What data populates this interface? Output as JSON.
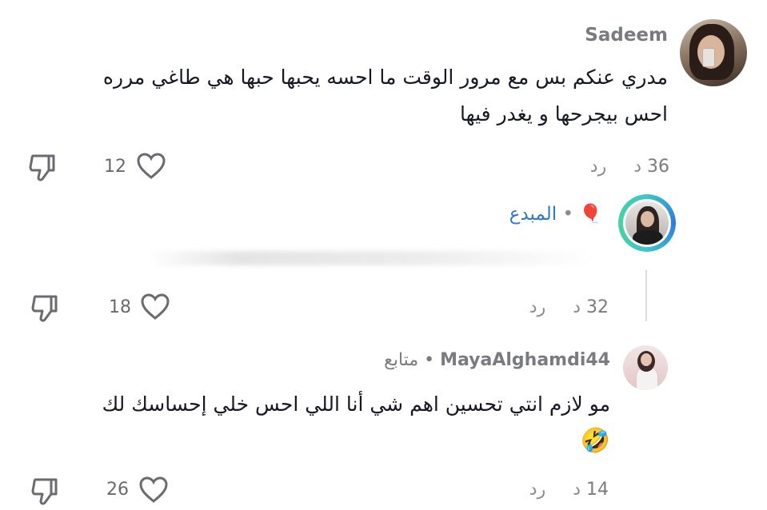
{
  "comments": [
    {
      "username": "Sadeem",
      "text_line1": "مدري عنكم بس مع مرور الوقت ما احسه يحبها حبها هي طاغي مرره",
      "text_line2": "احس بيجرحها و يغدر فيها",
      "time": "36",
      "time_unit": "د",
      "reply_label": "رد",
      "likes": "12"
    },
    {
      "username": "المبدع",
      "username_emoji": "🎈",
      "separator": "•",
      "time": "32",
      "time_unit": "د",
      "reply_label": "رد",
      "likes": "18"
    },
    {
      "username": "MayaAlghamdi44",
      "separator": "•",
      "badge": "متابع",
      "text": "مو لازم انتي تحسين اهم شي أنا اللي احس خلي إحساسك لك",
      "emoji": "🤣",
      "time": "14",
      "time_unit": "د",
      "reply_label": "رد",
      "likes": "26"
    }
  ],
  "icons": {
    "like": "heart-outline-icon",
    "dislike": "thumbs-down-outline-icon"
  },
  "colors": {
    "username_link": "#2f78c4",
    "muted_text": "#8a8b91"
  }
}
